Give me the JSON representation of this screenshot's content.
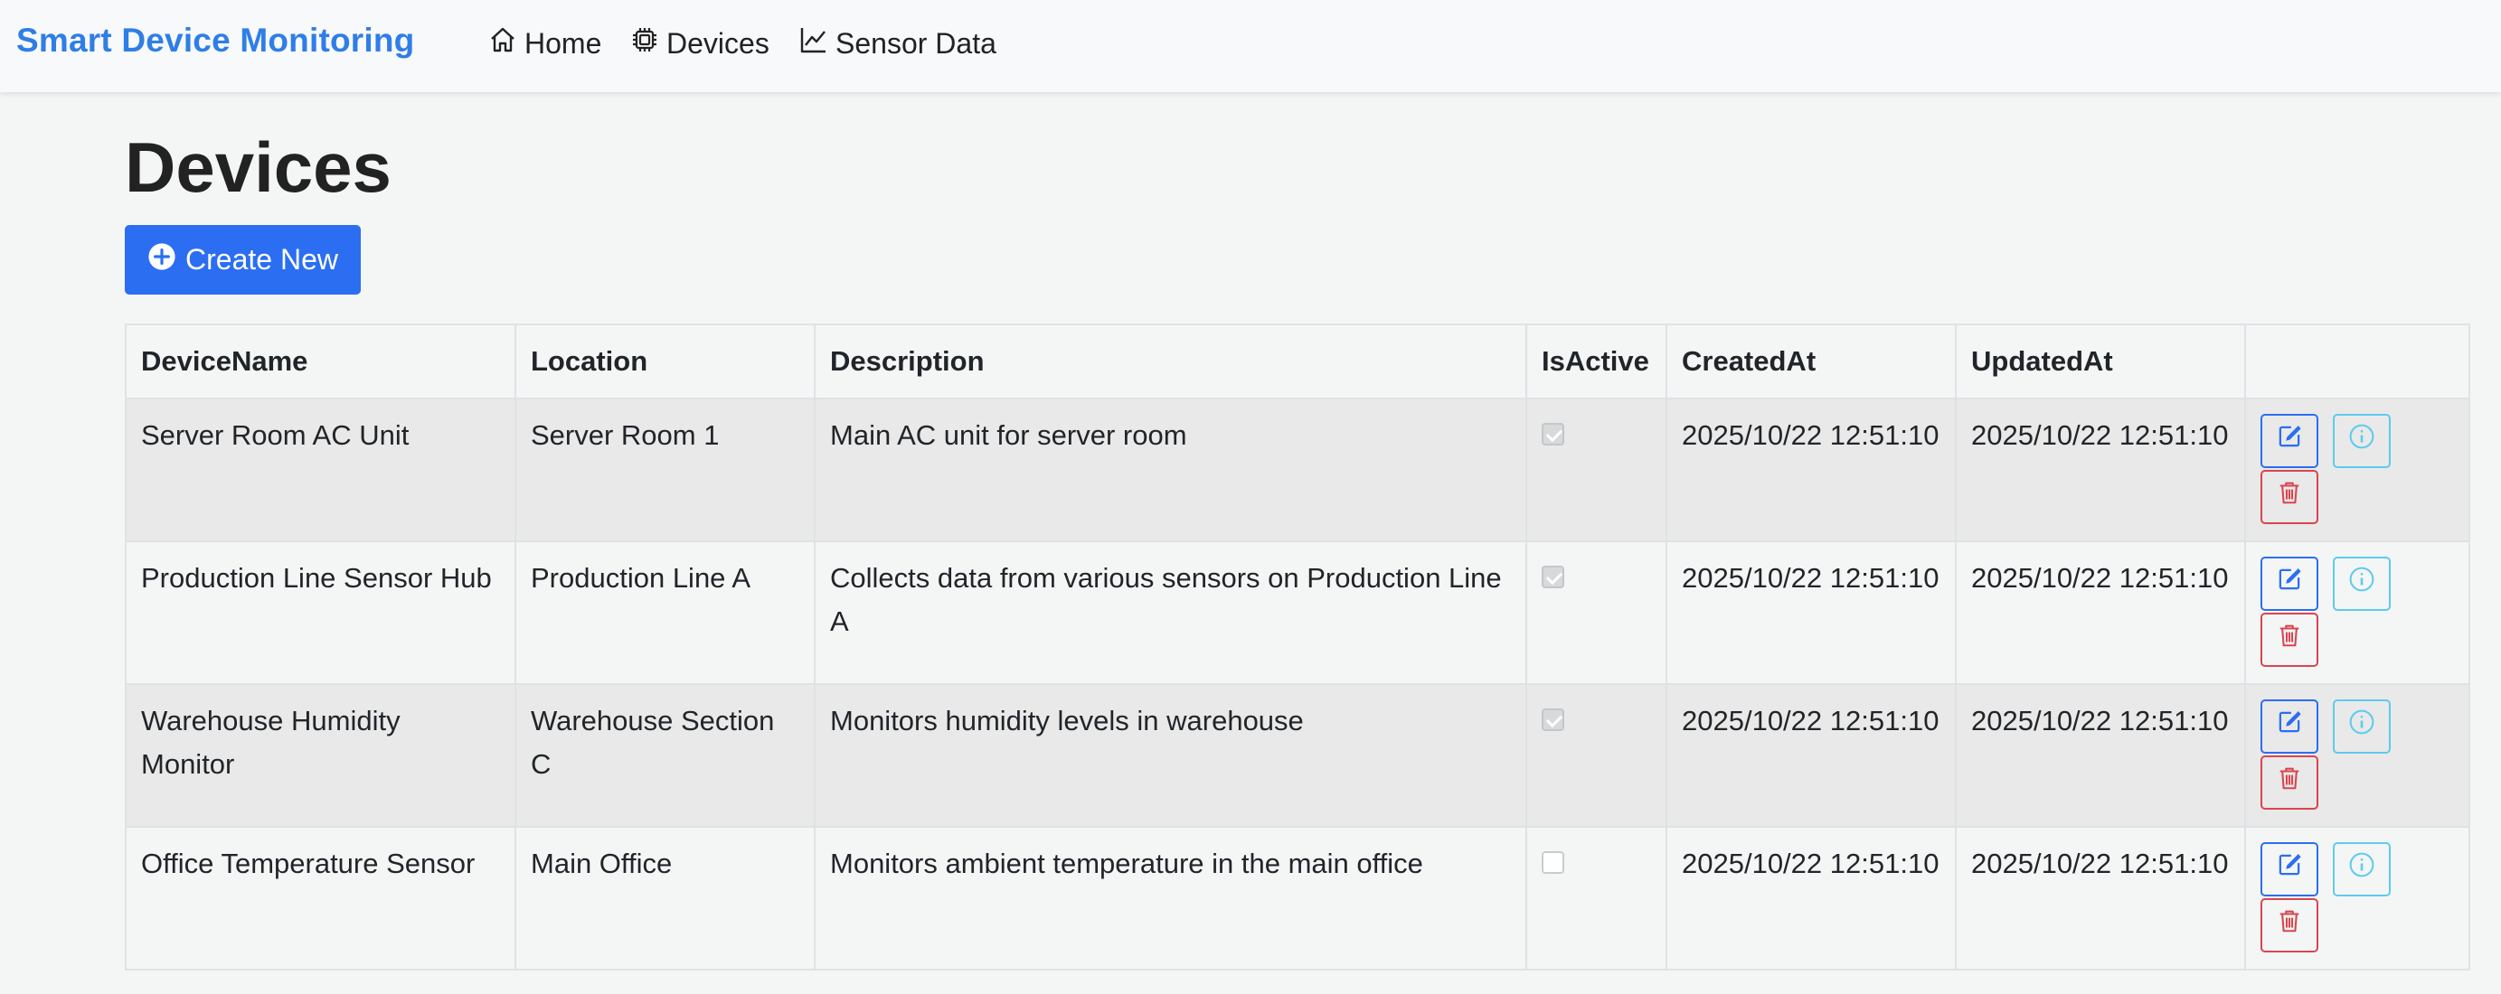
{
  "navbar": {
    "brand": "Smart Device Monitoring",
    "links": [
      {
        "label": "Home",
        "icon": "house-icon"
      },
      {
        "label": "Devices",
        "icon": "cpu-icon"
      },
      {
        "label": "Sensor Data",
        "icon": "chart-line-icon"
      }
    ]
  },
  "page": {
    "title": "Devices",
    "create_button_label": "Create New"
  },
  "table": {
    "headers": [
      "DeviceName",
      "Location",
      "Description",
      "IsActive",
      "CreatedAt",
      "UpdatedAt",
      ""
    ],
    "rows": [
      {
        "device_name": "Server Room AC Unit",
        "location": "Server Room 1",
        "description": "Main AC unit for server room",
        "is_active": true,
        "created_at": "2025/10/22 12:51:10",
        "updated_at": "2025/10/22 12:51:10"
      },
      {
        "device_name": "Production Line Sensor Hub",
        "location": "Production Line A",
        "description": "Collects data from various sensors on Production Line A",
        "is_active": true,
        "created_at": "2025/10/22 12:51:10",
        "updated_at": "2025/10/22 12:51:10"
      },
      {
        "device_name": "Warehouse Humidity Monitor",
        "location": "Warehouse Section C",
        "description": "Monitors humidity levels in warehouse",
        "is_active": true,
        "created_at": "2025/10/22 12:51:10",
        "updated_at": "2025/10/22 12:51:10"
      },
      {
        "device_name": "Office Temperature Sensor",
        "location": "Main Office",
        "description": "Monitors ambient temperature in the main office",
        "is_active": false,
        "created_at": "2025/10/22 12:51:10",
        "updated_at": "2025/10/22 12:51:10"
      }
    ]
  },
  "colors": {
    "brand": "#2f7ee8",
    "primary": "#2b6ef2",
    "info": "#5dcbee",
    "danger": "#d9454f"
  }
}
